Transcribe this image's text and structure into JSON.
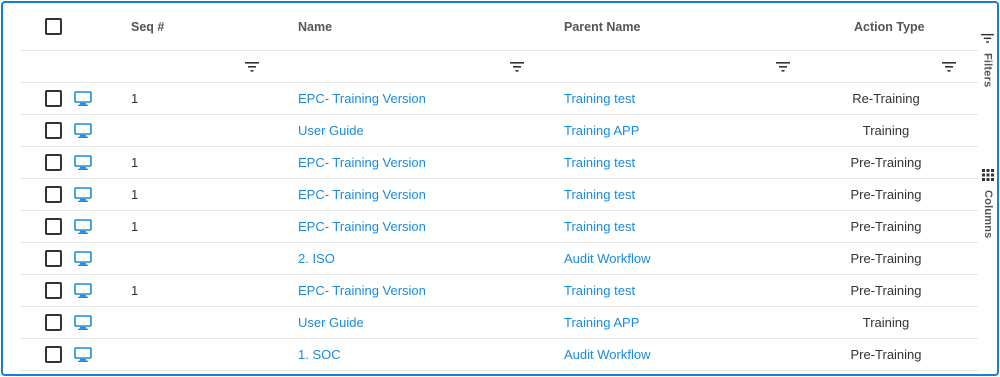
{
  "columns": {
    "seq": "Seq #",
    "name": "Name",
    "parent": "Parent Name",
    "action": "Action Type"
  },
  "side": {
    "filters": "Filters",
    "columns": "Columns"
  },
  "rows": [
    {
      "seq": "1",
      "name": "EPC- Training Version",
      "parent": "Training test",
      "action": "Re-Training"
    },
    {
      "seq": "",
      "name": "User Guide",
      "parent": "Training APP",
      "action": "Training"
    },
    {
      "seq": "1",
      "name": "EPC- Training Version",
      "parent": "Training test",
      "action": "Pre-Training"
    },
    {
      "seq": "1",
      "name": "EPC- Training Version",
      "parent": "Training test",
      "action": "Pre-Training"
    },
    {
      "seq": "1",
      "name": "EPC- Training Version",
      "parent": "Training test",
      "action": "Pre-Training"
    },
    {
      "seq": "",
      "name": "2. ISO",
      "parent": "Audit Workflow",
      "action": "Pre-Training"
    },
    {
      "seq": "1",
      "name": "EPC- Training Version",
      "parent": "Training test",
      "action": "Pre-Training"
    },
    {
      "seq": "",
      "name": "User Guide",
      "parent": "Training APP",
      "action": "Training"
    },
    {
      "seq": "",
      "name": "1. SOC",
      "parent": "Audit Workflow",
      "action": "Pre-Training"
    }
  ],
  "colors": {
    "link": "#1a8ae0",
    "border": "#1a7fd4",
    "icon": "#1a8ae0"
  }
}
